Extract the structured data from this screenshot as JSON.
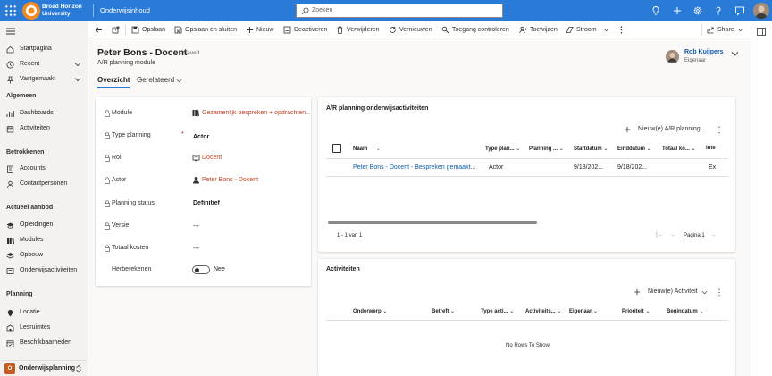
{
  "topbar": {
    "brand_line1": "Broad Horizon",
    "brand_line2": "University",
    "app_name": "Onderwijsinhoud",
    "search_placeholder": "Zoeken"
  },
  "sidebar": {
    "items_top": [
      {
        "label": "Startpagina",
        "icon": "home-icon"
      },
      {
        "label": "Recent",
        "icon": "clock-icon"
      },
      {
        "label": "Vastgemaakt",
        "icon": "pin-icon"
      }
    ],
    "groups": [
      {
        "title": "Algemeen",
        "items": [
          {
            "label": "Dashboards",
            "icon": "dashboard-icon"
          },
          {
            "label": "Activiteiten",
            "icon": "activities-icon"
          }
        ]
      },
      {
        "title": "Betrokkenen",
        "items": [
          {
            "label": "Accounts",
            "icon": "account-icon"
          },
          {
            "label": "Contactpersonen",
            "icon": "contact-icon"
          }
        ]
      },
      {
        "title": "Actueel aanbod",
        "items": [
          {
            "label": "Opleidingen",
            "icon": "education-icon"
          },
          {
            "label": "Modules",
            "icon": "modules-icon"
          },
          {
            "label": "Opbouw",
            "icon": "layers-icon"
          },
          {
            "label": "Onderwijsactiviteiten",
            "icon": "teaching-activities-icon"
          }
        ]
      },
      {
        "title": "Planning",
        "items": [
          {
            "label": "Locatie",
            "icon": "location-icon"
          },
          {
            "label": "Lesruimtes",
            "icon": "classroom-icon"
          },
          {
            "label": "Beschikbaarheden",
            "icon": "availability-icon"
          }
        ]
      }
    ],
    "area": {
      "badge": "O",
      "label": "Onderwijsplanning"
    }
  },
  "commands": [
    "Opslaan",
    "Opslaan en sluiten",
    "Nieuw",
    "Deactiveren",
    "Verwijderen",
    "Vernieuwen",
    "Toegang controleren",
    "Toewijzen",
    "Stroom"
  ],
  "share_label": "Share",
  "record": {
    "title": "Peter Bons - Docent",
    "saved": "- Saved",
    "entity": "A/R planning module",
    "owner_name": "Rob Kuijpers",
    "owner_role": "Eigenaar"
  },
  "tabs": {
    "overview": "Overzicht",
    "related": "Gerelateerd"
  },
  "form": {
    "fields": [
      {
        "label": "Module",
        "value": "Gezamenlijk bespreken + opdrachten...",
        "type": "link",
        "icon": "module-icon"
      },
      {
        "label": "Type planning",
        "value": "Actor",
        "type": "bold",
        "required": "*"
      },
      {
        "label": "Rol",
        "value": "Docent",
        "type": "link",
        "icon": "role-icon"
      },
      {
        "label": "Actor",
        "value": "Peter Bons - Docent",
        "type": "link",
        "icon": "actor-icon"
      },
      {
        "label": "Planning status",
        "value": "Definitief",
        "type": "bold"
      },
      {
        "label": "Versie",
        "value": "---",
        "type": "plain"
      },
      {
        "label": "Totaal kosten",
        "value": "---",
        "type": "plain"
      },
      {
        "label": "Herberekenen",
        "value": "Nee",
        "type": "toggle"
      }
    ]
  },
  "ar_grid": {
    "title": "A/R planning onderwijsactiviteiten",
    "new_label": "Nieuw(e) A/R planning...",
    "columns": [
      "Naam",
      "Type plan...",
      "Planning ...",
      "Startdatum",
      "Einddatum",
      "Totaal ko...",
      "Inte"
    ],
    "rows": [
      [
        "Peter Bons - Docent - Bespreken gemaakt...",
        "Actor",
        "",
        "9/18/202...",
        "9/18/202...",
        "",
        "Ex"
      ]
    ],
    "footer_count": "1 - 1 van 1",
    "page_label": "Pagina 1"
  },
  "act_grid": {
    "title": "Activiteiten",
    "new_label": "Nieuw(e) Activiteit",
    "columns": [
      "Onderwerp",
      "Betreft",
      "Type acti...",
      "Activiteits...",
      "Eigenaar",
      "Prioriteit",
      "Begindatum"
    ],
    "empty": "No Rows To Show"
  }
}
